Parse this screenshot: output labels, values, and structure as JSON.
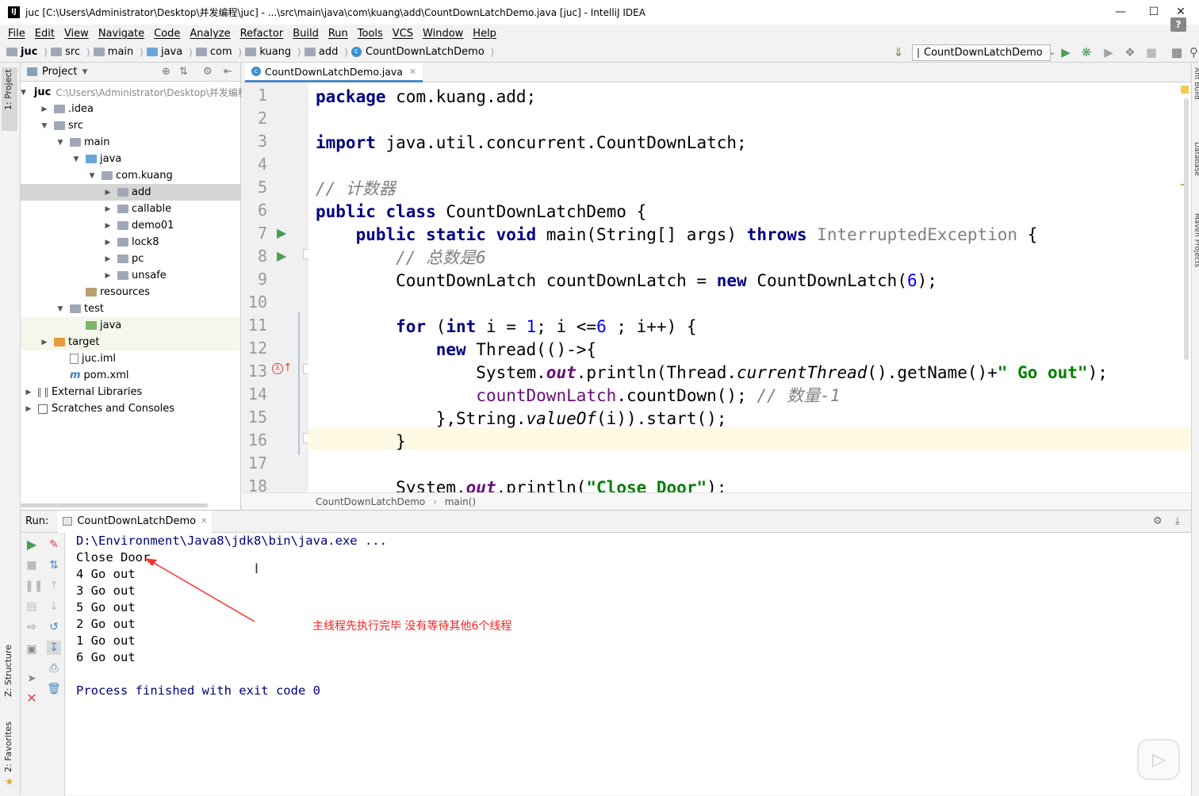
{
  "window": {
    "title": "juc [C:\\Users\\Administrator\\Desktop\\并发编程\\juc] - ...\\src\\main\\java\\com\\kuang\\add\\CountDownLatchDemo.java [juc] - IntelliJ IDEA",
    "app_icon": "IJ"
  },
  "menu": [
    "File",
    "Edit",
    "View",
    "Navigate",
    "Code",
    "Analyze",
    "Refactor",
    "Build",
    "Run",
    "Tools",
    "VCS",
    "Window",
    "Help"
  ],
  "breadcrumbs": [
    "juc",
    "src",
    "main",
    "java",
    "com",
    "kuang",
    "add",
    "CountDownLatchDemo"
  ],
  "run_config": {
    "name": "CountDownLatchDemo"
  },
  "project_panel": {
    "title": "Project",
    "tree": [
      {
        "label": "juc",
        "path": "C:\\Users\\Administrator\\Desktop\\并发编程\\juc"
      },
      {
        "label": ".idea"
      },
      {
        "label": "src"
      },
      {
        "label": "main"
      },
      {
        "label": "java"
      },
      {
        "label": "com.kuang"
      },
      {
        "label": "add"
      },
      {
        "label": "callable"
      },
      {
        "label": "demo01"
      },
      {
        "label": "lock8"
      },
      {
        "label": "pc"
      },
      {
        "label": "unsafe"
      },
      {
        "label": "resources"
      },
      {
        "label": "test"
      },
      {
        "label": "java"
      },
      {
        "label": "target"
      },
      {
        "label": "juc.iml"
      },
      {
        "label": "pom.xml"
      },
      {
        "label": "External Libraries"
      },
      {
        "label": "Scratches and Consoles"
      }
    ]
  },
  "side_tabs": {
    "project": "1: Project",
    "structure": "Z: Structure",
    "favorites": "2: Favorites",
    "ant": "Ant Build",
    "database": "Database",
    "maven": "Maven Projects"
  },
  "editor": {
    "tab": "CountDownLatchDemo.java",
    "line_numbers": [
      "1",
      "2",
      "3",
      "4",
      "5",
      "6",
      "7",
      "8",
      "9",
      "10",
      "11",
      "12",
      "13",
      "14",
      "15",
      "16",
      "17",
      "18"
    ],
    "code": {
      "l1_kw": "package",
      "l1_rest": " com.kuang.add;",
      "l3_kw": "import",
      "l3_rest": " java.util.concurrent.CountDownLatch;",
      "l5": "// 计数器",
      "l6_kw": "public class",
      "l6_rest": " CountDownLatchDemo {",
      "l7_kw1": "    public static void",
      "l7_mid": " main(String[] args) ",
      "l7_kw2": "throws",
      "l7_gray": " InterruptedException",
      "l7_end": " {",
      "l8": "        // 总数是6",
      "l9_a": "        CountDownLatch countDownLatch = ",
      "l9_kw": "new",
      "l9_b": " CountDownLatch(",
      "l9_num": "6",
      "l9_c": ");",
      "l11_a": "        ",
      "l11_kw1": "for",
      "l11_b": " (",
      "l11_kw2": "int",
      "l11_c": " i = ",
      "l11_n1": "1",
      "l11_d": "; i <=",
      "l11_n2": "6",
      "l11_e": " ; i++) {",
      "l12_a": "            ",
      "l12_kw": "new",
      "l12_b": " Thread(()->{",
      "l13_a": "                System.",
      "l13_fld": "out",
      "l13_b": ".println(Thread.",
      "l13_it": "currentThread",
      "l13_c": "().getName()+",
      "l13_str": "\" Go out\"",
      "l13_d": ");",
      "l14_a": "                ",
      "l14_pur": "countDownLatch",
      "l14_b": ".countDown(); ",
      "l14_cm": "// 数量-1",
      "l15": "            },String.",
      "l15_it": "valueOf",
      "l15_b": "(i)).start();",
      "l16": "        }",
      "l18_a": "        System.",
      "l18_fld": "out",
      "l18_b": ".println(",
      "l18_str": "\"Close Door\"",
      "l18_c": ");"
    },
    "breadcrumb": [
      "CountDownLatchDemo",
      "main()"
    ]
  },
  "run_panel": {
    "label": "Run:",
    "tab": "CountDownLatchDemo",
    "console": [
      "D:\\Environment\\Java8\\jdk8\\bin\\java.exe ...",
      "Close Door",
      "4 Go out",
      "3 Go out",
      "5 Go out",
      "2 Go out",
      "1 Go out",
      "6 Go out",
      "",
      "Process finished with exit code 0"
    ],
    "annotation": "主线程先执行完毕  没有等待其他6个线程"
  },
  "colors": {
    "keyword": "#000080",
    "string": "#008000",
    "comment": "#808080",
    "number": "#0000ff",
    "field": "#660e7a",
    "annotation": "#ff2020",
    "accent": "#4a88c7"
  }
}
